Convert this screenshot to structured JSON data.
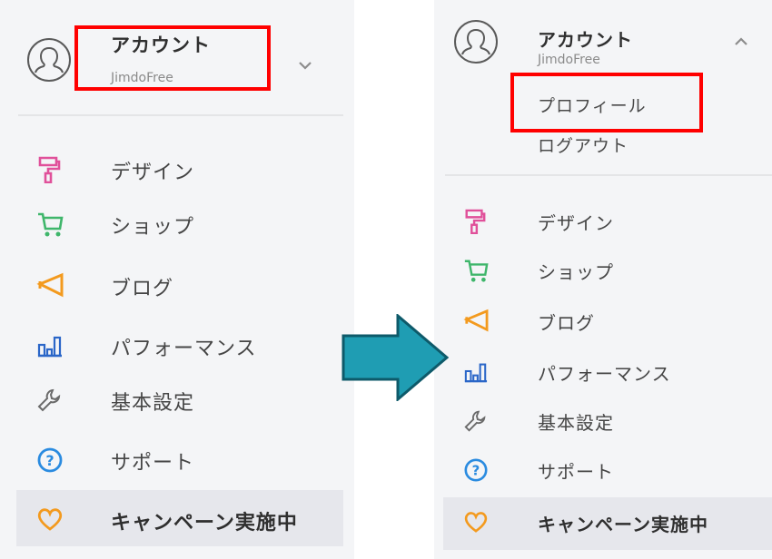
{
  "account": {
    "title": "アカウント",
    "subtitle": "JimdoFree",
    "avatar_icon": "user-avatar-icon",
    "collapsed_icon": "chevron-down-icon",
    "expanded_icon": "chevron-up-icon"
  },
  "account_submenu": {
    "profile": "プロフィール",
    "logout": "ログアウト"
  },
  "menu": {
    "design": {
      "label": "デザイン",
      "icon": "paint-roller-icon",
      "color": "#e0509a"
    },
    "shop": {
      "label": "ショップ",
      "icon": "cart-icon",
      "color": "#3fb66b"
    },
    "blog": {
      "label": "ブログ",
      "icon": "megaphone-icon",
      "color": "#f39a1e"
    },
    "performance": {
      "label": "パフォーマンス",
      "icon": "bar-chart-icon",
      "color": "#2a66c8"
    },
    "settings": {
      "label": "基本設定",
      "icon": "wrench-icon",
      "color": "#6a6a6a"
    },
    "support": {
      "label": "サポート",
      "icon": "help-circle-icon",
      "color": "#2a8be0"
    },
    "campaign": {
      "label": "キャンペーン実施中",
      "icon": "heart-icon",
      "color": "#f39a1e"
    }
  },
  "colors": {
    "highlight_box": "#ff0000",
    "arrow_fill": "#1f9db3",
    "arrow_stroke": "#0e5a6a",
    "panel_bg": "#f4f5f7"
  }
}
